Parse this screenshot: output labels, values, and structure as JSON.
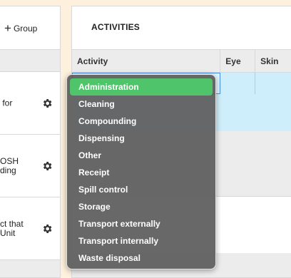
{
  "left_panel": {
    "group_button_label": "Group",
    "rows": [
      {
        "text": " for"
      },
      {
        "text": "OSH\nding"
      },
      {
        "text": "ct that\nUnit"
      }
    ]
  },
  "right_panel": {
    "section_title": "ACTIVITIES",
    "columns": {
      "activity": "Activity",
      "eye": "Eye",
      "skin": "Skin"
    }
  },
  "dropdown": {
    "selected": "Administration",
    "options": [
      "Administration",
      "Cleaning",
      "Compounding",
      "Dispensing",
      "Other",
      "Receipt",
      "Spill control",
      "Storage",
      "Transport externally",
      "Transport internally",
      "Waste disposal"
    ]
  },
  "colors": {
    "accent_green": "#4fc46a",
    "selected_row": "#cdeefa",
    "dropdown_bg": "#5c5c5c"
  },
  "icons": {
    "plus": "plus-icon",
    "gear": "gear-icon"
  }
}
